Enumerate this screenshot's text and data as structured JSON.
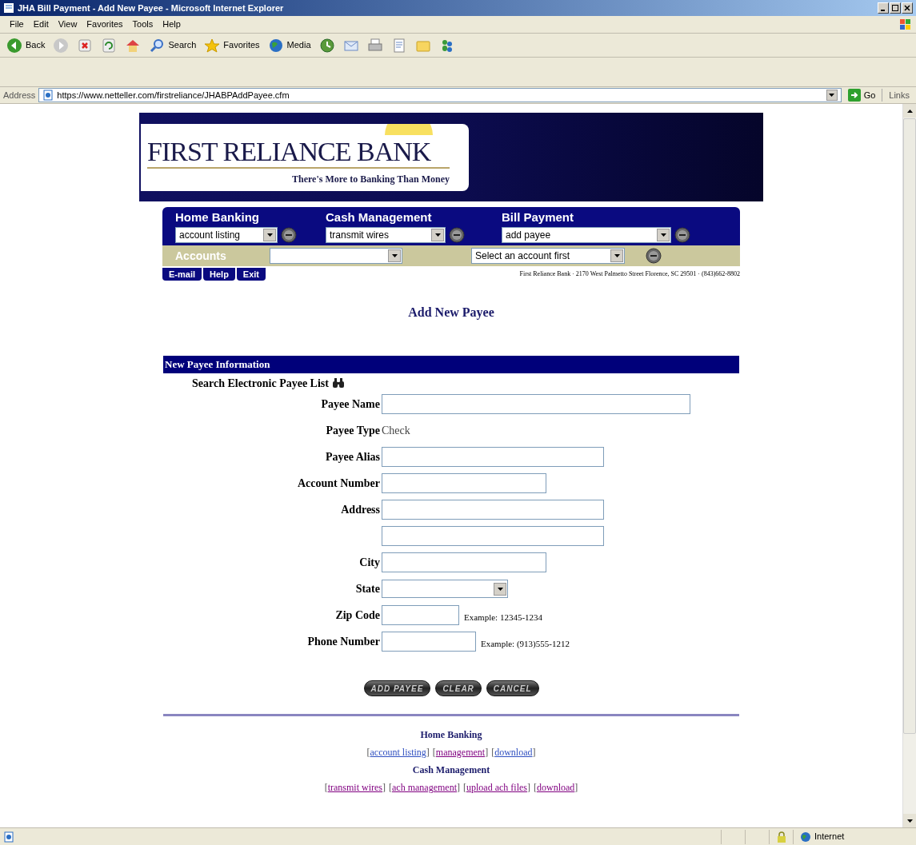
{
  "window": {
    "title": "JHA Bill Payment - Add New Payee - Microsoft Internet Explorer"
  },
  "menu": [
    "File",
    "Edit",
    "View",
    "Favorites",
    "Tools",
    "Help"
  ],
  "toolbar": [
    {
      "kind": "back",
      "label": "Back"
    },
    {
      "kind": "forward"
    },
    {
      "kind": "stop"
    },
    {
      "kind": "refresh"
    },
    {
      "kind": "home"
    },
    {
      "kind": "search",
      "label": "Search"
    },
    {
      "kind": "favorites",
      "label": "Favorites"
    },
    {
      "kind": "media",
      "label": "Media"
    },
    {
      "kind": "history"
    },
    {
      "kind": "mail"
    },
    {
      "kind": "print"
    },
    {
      "kind": "edit"
    },
    {
      "kind": "folder"
    },
    {
      "kind": "messenger"
    }
  ],
  "address_bar": {
    "label": "Address",
    "value": "https://www.netteller.com/firstreliance/JHABPAddPayee.cfm",
    "go": "Go",
    "links": "Links"
  },
  "banner": {
    "name": "FIRST RELIANCE BANK",
    "tagline": "There's More to Banking Than Money"
  },
  "nav": {
    "groups": [
      {
        "title": "Home Banking",
        "select": "account listing"
      },
      {
        "title": "Cash Management",
        "select": "transmit wires"
      },
      {
        "title": "Bill Payment",
        "select": "add payee"
      }
    ],
    "accounts_label": "Accounts",
    "account_action": "Select an account first",
    "links": [
      "E-mail",
      "Help",
      "Exit"
    ],
    "address": "First Reliance Bank · 2170 West Palmetto Street Florence, SC 29501 · (843)662-8802"
  },
  "page_title": "Add New Payee",
  "form": {
    "header": "New Payee Information",
    "search_label": "Search Electronic Payee List",
    "fields": [
      {
        "kind": "long",
        "label": "Payee Name"
      },
      {
        "kind": "static",
        "label": "Payee Type",
        "value": "Check"
      },
      {
        "kind": "wide",
        "label": "Payee Alias"
      },
      {
        "kind": "medium",
        "label": "Account Number"
      },
      {
        "kind": "wide",
        "label": "Address"
      },
      {
        "kind": "wide"
      },
      {
        "kind": "medium",
        "label": "City"
      },
      {
        "kind": "select",
        "label": "State"
      },
      {
        "kind": "short",
        "label": "Zip Code",
        "example": "Example: 12345-1234"
      },
      {
        "kind": "phone",
        "label": "Phone Number",
        "example": "Example: (913)555-1212"
      }
    ],
    "buttons": [
      "ADD PAYEE",
      "CLEAR",
      "CANCEL"
    ]
  },
  "footer": {
    "brackets": [
      "[",
      "]"
    ],
    "sections": [
      {
        "title": "Home Banking",
        "links": [
          {
            "label": "account listing",
            "visited": false
          },
          {
            "label": "management",
            "visited": true
          },
          {
            "label": "download",
            "visited": false
          }
        ]
      },
      {
        "title": "Cash Management",
        "links": [
          {
            "label": "transmit wires",
            "visited": true
          },
          {
            "label": "ach management",
            "visited": true
          },
          {
            "label": "upload ach files",
            "visited": true
          },
          {
            "label": "download",
            "visited": true
          }
        ]
      }
    ]
  },
  "status_bar": {
    "zone": "Internet"
  }
}
